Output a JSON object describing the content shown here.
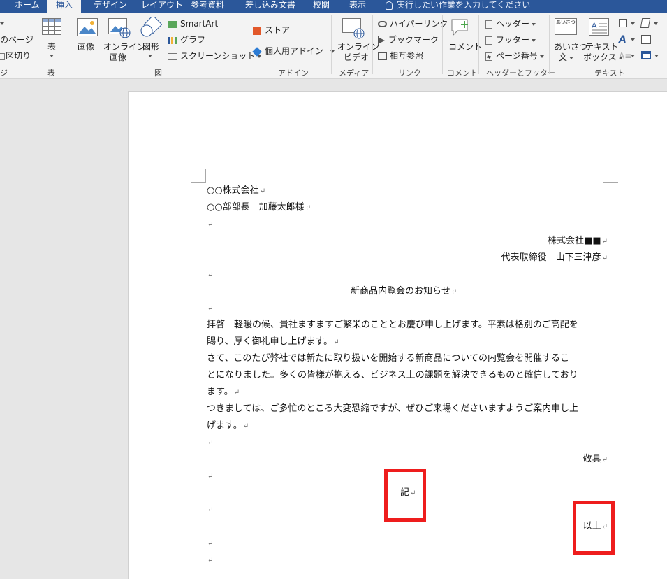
{
  "tabs": {
    "home": "ホーム",
    "insert": "挿入",
    "design": "デザイン",
    "layout": "レイアウト",
    "references": "参考資料",
    "mailings": "差し込み文書",
    "review": "校閲",
    "view": "表示",
    "tell_me": "実行したい作業を入力してください"
  },
  "ribbon": {
    "pages": {
      "partial_label_1": "のページ",
      "partial_label_2": "区切り",
      "group_partial": "ジ"
    },
    "tables": {
      "table_label": "表",
      "group": "表"
    },
    "illustrations": {
      "pictures": "画像",
      "online_pictures_1": "オンライン",
      "online_pictures_2": "画像",
      "shapes": "図形",
      "smartart": "SmartArt",
      "chart": "グラフ",
      "screenshot": "スクリーンショット",
      "group": "図"
    },
    "addins": {
      "store": "ストア",
      "my_addins": "個人用アドイン",
      "group": "アドイン"
    },
    "media": {
      "online_video_1": "オンライン",
      "online_video_2": "ビデオ",
      "group": "メディア"
    },
    "links": {
      "hyperlink": "ハイパーリンク",
      "bookmark": "ブックマーク",
      "cross_reference": "相互参照",
      "group": "リンク"
    },
    "comments": {
      "comment": "コメント",
      "group": "コメント"
    },
    "header_footer": {
      "header": "ヘッダー",
      "footer": "フッター",
      "page_number": "ページ番号",
      "group": "ヘッダーとフッター"
    },
    "text": {
      "greeting_1": "あいさつ",
      "greeting_2": "文",
      "greeting_icon_text": "あいさつ",
      "textbox_1": "テキスト",
      "textbox_2": "ボックス",
      "group": "テキスト"
    }
  },
  "document": {
    "lines": [
      "○○株式会社",
      "○○部部長　加藤太郎様",
      "",
      "株式会社■■",
      "代表取締役　山下三津彦",
      "",
      "新商品内覧会のお知らせ",
      "",
      "拝啓　軽暖の候、貴社ますますご繁栄のこととお慶び申し上げます。平素は格別のご高配を",
      "賜り、厚く御礼申し上げます。",
      "さて、このたび弊社では新たに取り扱いを開始する新商品についての内覧会を開催するこ",
      "とになりました。多くの皆様が抱える、ビジネス上の課題を解決できるものと確信しており",
      "ます。",
      "つきましては、ご多忙のところ大変恐縮ですが、ぜひご来場くださいますようご案内申し上",
      "げます。",
      "",
      "敬具",
      "",
      "記",
      "",
      "以上",
      "",
      ""
    ],
    "paragraph_mark": "↵"
  },
  "colors": {
    "accent": "#2b579a",
    "highlight": "#ee1d1d"
  }
}
